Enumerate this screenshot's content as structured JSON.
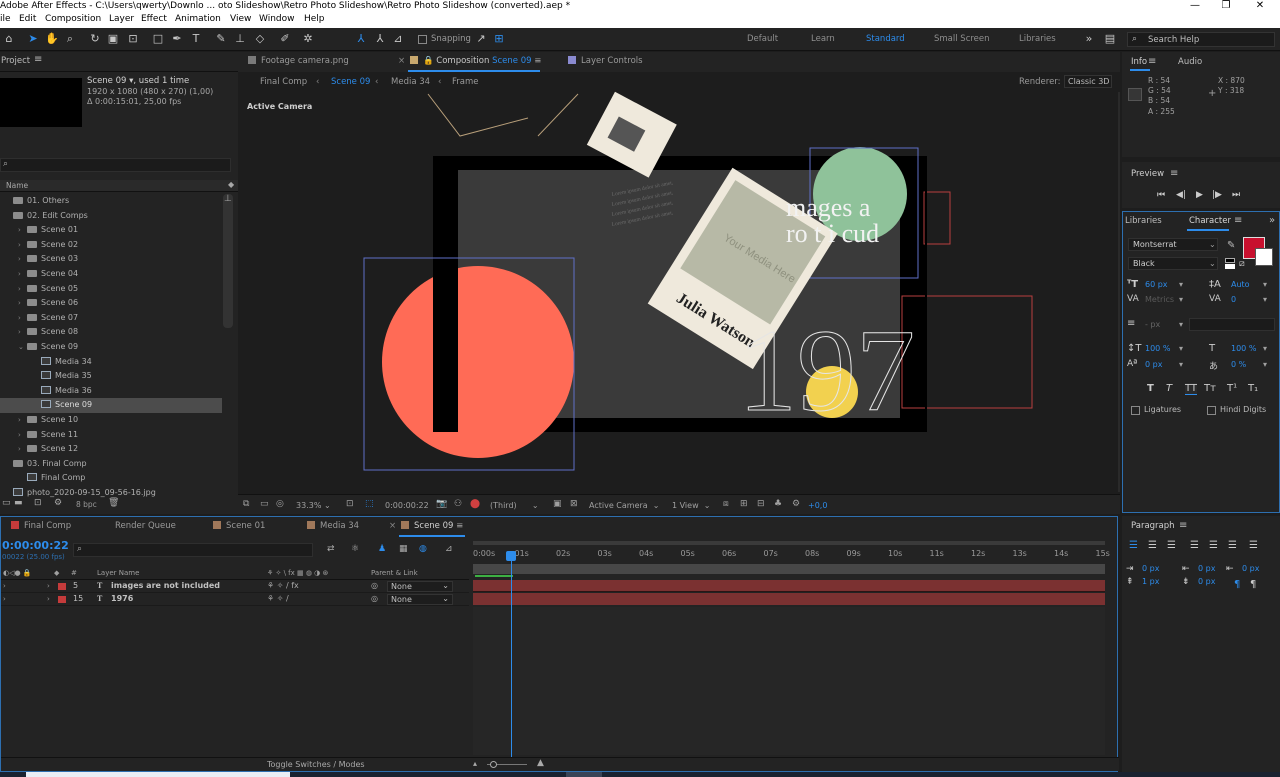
{
  "window": {
    "title": "Adobe After Effects - C:\\Users\\qwerty\\Downlo ... oto Slideshow\\Retro Photo Slideshow\\Retro Photo Slideshow (converted).aep *"
  },
  "menu": [
    "ile",
    "Edit",
    "Composition",
    "Layer",
    "Effect",
    "Animation",
    "View",
    "Window",
    "Help"
  ],
  "toolbar": {
    "snapping": "Snapping",
    "workspaces": [
      "Default",
      "Learn",
      "Standard",
      "Small Screen",
      "Libraries"
    ],
    "active_workspace": "Standard",
    "search_help": "Search Help"
  },
  "project": {
    "title": "Project",
    "selected_name": "Scene 09",
    "selected_usage": ", used 1 time",
    "selected_size": "1920 x 1080  (480 x 270) (1,00)",
    "selected_duration": "Δ 0:00:15:01, 25,00 fps",
    "search_placeholder": "",
    "column_name": "Name",
    "items": [
      {
        "label": "01. Others",
        "kind": "folder",
        "indent": 0,
        "twirl": ""
      },
      {
        "label": "02. Edit Comps",
        "kind": "folder",
        "indent": 0,
        "twirl": ""
      },
      {
        "label": "Scene 01",
        "kind": "folder",
        "indent": 1,
        "twirl": "›"
      },
      {
        "label": "Scene 02",
        "kind": "folder",
        "indent": 1,
        "twirl": "›"
      },
      {
        "label": "Scene 03",
        "kind": "folder",
        "indent": 1,
        "twirl": "›"
      },
      {
        "label": "Scene 04",
        "kind": "folder",
        "indent": 1,
        "twirl": "›"
      },
      {
        "label": "Scene 05",
        "kind": "folder",
        "indent": 1,
        "twirl": "›"
      },
      {
        "label": "Scene 06",
        "kind": "folder",
        "indent": 1,
        "twirl": "›"
      },
      {
        "label": "Scene 07",
        "kind": "folder",
        "indent": 1,
        "twirl": "›"
      },
      {
        "label": "Scene 08",
        "kind": "folder",
        "indent": 1,
        "twirl": "›"
      },
      {
        "label": "Scene 09",
        "kind": "folder",
        "indent": 1,
        "twirl": "⌄"
      },
      {
        "label": "Media 34",
        "kind": "comp",
        "indent": 2,
        "twirl": ""
      },
      {
        "label": "Media 35",
        "kind": "comp",
        "indent": 2,
        "twirl": ""
      },
      {
        "label": "Media 36",
        "kind": "comp",
        "indent": 2,
        "twirl": ""
      },
      {
        "label": "Scene 09",
        "kind": "comp",
        "indent": 2,
        "twirl": "",
        "selected": true
      },
      {
        "label": "Scene 10",
        "kind": "folder",
        "indent": 1,
        "twirl": "›"
      },
      {
        "label": "Scene 11",
        "kind": "folder",
        "indent": 1,
        "twirl": "›"
      },
      {
        "label": "Scene 12",
        "kind": "folder",
        "indent": 1,
        "twirl": "›"
      },
      {
        "label": "03. Final Comp",
        "kind": "folder",
        "indent": 0,
        "twirl": ""
      },
      {
        "label": "Final Comp",
        "kind": "comp",
        "indent": 1,
        "twirl": ""
      },
      {
        "label": "photo_2020-09-15_09-56-16.jpg",
        "kind": "image",
        "indent": 0,
        "twirl": ""
      }
    ],
    "bpc": "8 bpc"
  },
  "viewer": {
    "tabs": [
      {
        "label": "Footage  camera.png",
        "color": "#7a7a7a"
      },
      {
        "label": "Composition",
        "highlight": "Scene 09",
        "color": "#c8a86e"
      },
      {
        "label": "Layer  Controls",
        "color": "#8a8ad0"
      }
    ],
    "breadcrumbs": [
      "Final Comp",
      "Scene 09",
      "Media 34",
      "Frame"
    ],
    "renderer_label": "Renderer:",
    "renderer_value": "Classic 3D",
    "active_camera": "Active Camera",
    "artwork": {
      "heading_line1": "mages  a",
      "heading_line2": "ro t i  cud",
      "name_on_card": "Julia Watson",
      "placeholder_on_card": "Your Media Here",
      "year": "197",
      "lorem": "Lorem ipsum dolor sit amet,"
    },
    "footer": {
      "zoom": "33.3%",
      "timecode": "0:00:00:22",
      "resolution": "(Third)",
      "camera": "Active Camera",
      "views": "1 View",
      "exposure": "+0,0"
    }
  },
  "info": {
    "tabs": [
      "Info",
      "Audio"
    ],
    "r": "R : 54",
    "g": "G : 54",
    "b": "B : 54",
    "a": "A : 255",
    "x": "X : 870",
    "y": "Y : 318"
  },
  "preview": {
    "title": "Preview"
  },
  "character": {
    "tabs": [
      "Libraries",
      "Character"
    ],
    "font": "Montserrat",
    "style": "Black",
    "size": "60 px",
    "leading": "Auto",
    "kerning": "Metrics",
    "tracking": "0",
    "stroke": "- px",
    "vscale": "100 %",
    "hscale": "100 %",
    "baseline": "0 px",
    "tsume": "0 %",
    "ligatures": "Ligatures",
    "hindi": "Hindi Digits",
    "fill_color": "#c8102e",
    "styles": [
      "T",
      "T",
      "TT",
      "Tт",
      "T¹",
      "T₁"
    ]
  },
  "paragraph": {
    "title": "Paragraph",
    "indent_left": "0 px",
    "indent_first": "0 px",
    "space_before": "1 px",
    "space_after": "0 px",
    "indent_right": "0 px"
  },
  "timeline": {
    "tabs": [
      {
        "label": "Final Comp",
        "color": "#c43b3b"
      },
      {
        "label": "Render Queue",
        "color": ""
      },
      {
        "label": "Scene 01",
        "color": "#a0785a"
      },
      {
        "label": "Media 34",
        "color": "#a0785a"
      },
      {
        "label": "Scene 09",
        "color": "#a0785a"
      }
    ],
    "timecode": "0:00:00:22",
    "frames": "00022 (25.00 fps)",
    "col_layer_name": "Layer Name",
    "col_parent": "Parent & Link",
    "layers": [
      {
        "num": "5",
        "name": "images are not included",
        "parent": "None",
        "color": "#c43b3b"
      },
      {
        "num": "15",
        "name": "1976",
        "parent": "None",
        "color": "#c43b3b"
      }
    ],
    "ruler": [
      "0:00s",
      "01s",
      "02s",
      "03s",
      "04s",
      "05s",
      "06s",
      "07s",
      "08s",
      "09s",
      "10s",
      "11s",
      "12s",
      "13s",
      "14s",
      "15s"
    ],
    "toggle_label": "Toggle Switches / Modes"
  }
}
